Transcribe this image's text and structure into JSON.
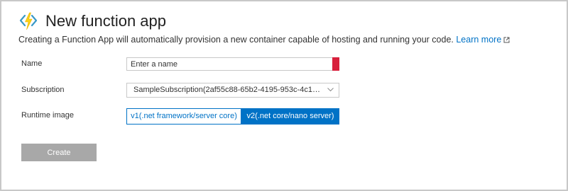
{
  "header": {
    "title": "New function app",
    "description": "Creating a Function App will automatically provision a new container capable of hosting and running your code.",
    "learn_more": "Learn more",
    "logo_icon": "azure-functions-bolt-icon"
  },
  "form": {
    "name": {
      "label": "Name",
      "placeholder": "Enter a name",
      "status": "invalid"
    },
    "subscription": {
      "label": "Subscription",
      "value": "SampleSubscription(2af55c88-65b2-4195-953c-4c10d97..."
    },
    "runtime": {
      "label": "Runtime image",
      "options": [
        "v1(.net framework/server core)",
        "v2(.net core/nano server)"
      ],
      "selected": "v2(.net core/nano server)"
    },
    "create_label": "Create"
  },
  "colors": {
    "accent": "#0072c6",
    "error": "#d8203c",
    "disabled": "#a8a8a8",
    "logo": "#3999c6"
  }
}
